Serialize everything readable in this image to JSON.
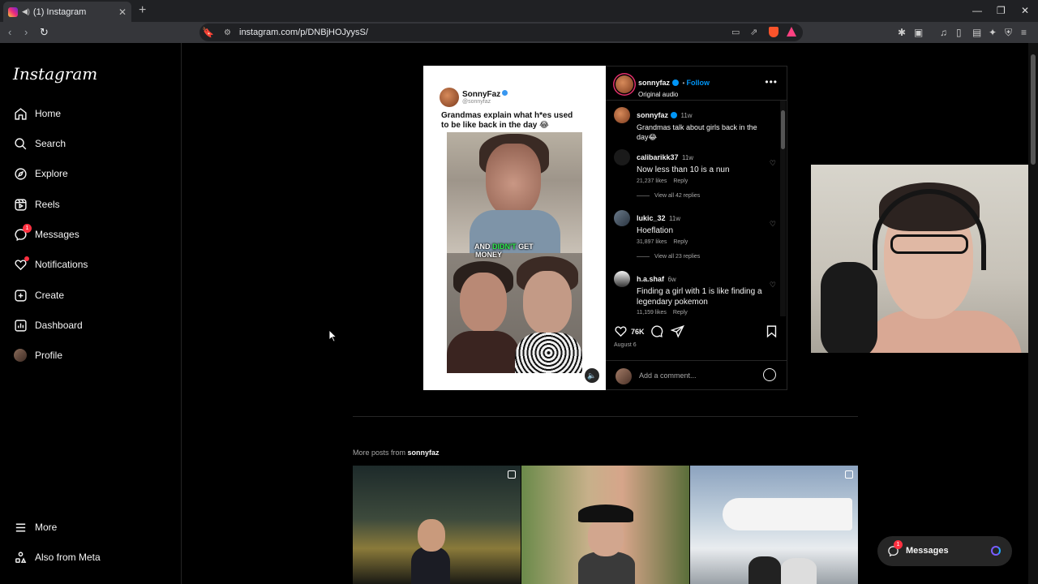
{
  "browser": {
    "tab_title": "(1) Instagram",
    "url": "instagram.com/p/DNBjHOJyysS/"
  },
  "sidebar": {
    "logo": "Instagram",
    "items": [
      {
        "label": "Home",
        "icon": "home-icon"
      },
      {
        "label": "Search",
        "icon": "search-icon"
      },
      {
        "label": "Explore",
        "icon": "compass-icon"
      },
      {
        "label": "Reels",
        "icon": "reels-icon"
      },
      {
        "label": "Messages",
        "icon": "messenger-icon",
        "badge": "1"
      },
      {
        "label": "Notifications",
        "icon": "heart-icon"
      },
      {
        "label": "Create",
        "icon": "plus-square-icon"
      },
      {
        "label": "Dashboard",
        "icon": "chart-icon"
      },
      {
        "label": "Profile",
        "icon": "avatar"
      }
    ],
    "more": "More",
    "also_from_meta": "Also from Meta"
  },
  "post": {
    "media": {
      "name": "SonnyFaz",
      "handle": "@sonnyfaz",
      "caption": "Grandmas explain what h*es used to be like back in the day 😂",
      "subtitle_a": "AND ",
      "subtitle_b": "DIDN'T",
      "subtitle_c": " GET",
      "subtitle_d": "MONEY"
    },
    "author": "sonnyfaz",
    "follow": "Follow",
    "audio": "Original audio",
    "caption_comment": {
      "user": "sonnyfaz",
      "time": "11w",
      "text": "Grandmas talk about girls back in the day😂"
    },
    "comments": [
      {
        "user": "calibarikk37",
        "time": "11w",
        "text": "Now less than 10 is a nun",
        "likes": "21,237 likes",
        "reply": "Reply",
        "view_replies": "View all 42 replies"
      },
      {
        "user": "lukic_32",
        "time": "11w",
        "text": "Hoeflation",
        "likes": "31,897 likes",
        "reply": "Reply",
        "view_replies": "View all 23 replies"
      },
      {
        "user": "h.a.shaf",
        "time": "6w",
        "text": "Finding a girl with 1 is like finding a legendary pokemon",
        "likes": "11,159 likes",
        "reply": "Reply"
      }
    ],
    "like_count": "76K",
    "date": "August 6",
    "add_comment_placeholder": "Add a comment..."
  },
  "more_posts": {
    "prefix": "More posts from ",
    "user": "sonnyfaz"
  },
  "messages_pill": {
    "label": "Messages",
    "badge": "1"
  }
}
